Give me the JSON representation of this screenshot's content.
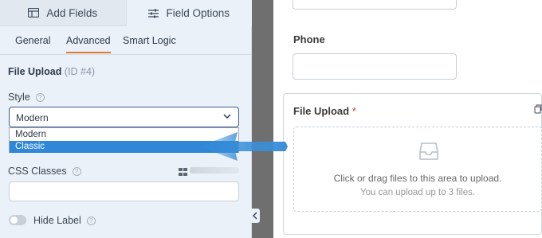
{
  "tabs": {
    "add_fields": "Add Fields",
    "field_options": "Field Options"
  },
  "subtabs": [
    "General",
    "Advanced",
    "Smart Logic"
  ],
  "field": {
    "name": "File Upload",
    "id_text": "(ID #4)"
  },
  "style": {
    "label": "Style",
    "selected": "Modern",
    "options": [
      "Modern",
      "Classic"
    ]
  },
  "css_classes": {
    "label": "CSS Classes",
    "value": ""
  },
  "hide_label": {
    "label": "Hide Label",
    "on": false
  },
  "preview": {
    "phone_label": "Phone",
    "upload_label": "File Upload",
    "required_mark": "*",
    "drop_main": "Click or drag files to this area to upload.",
    "drop_sub": "You can upload up to 3 files."
  },
  "colors": {
    "accent_orange": "#e27730",
    "selection_blue": "#2f87d8",
    "arrow_blue": "#3a8ed8"
  },
  "icons": [
    "table-icon",
    "sliders-icon",
    "help-icon",
    "chevron-down-icon",
    "columns-icon",
    "inbox-icon",
    "chevron-left-icon",
    "arrow-left-icon"
  ]
}
